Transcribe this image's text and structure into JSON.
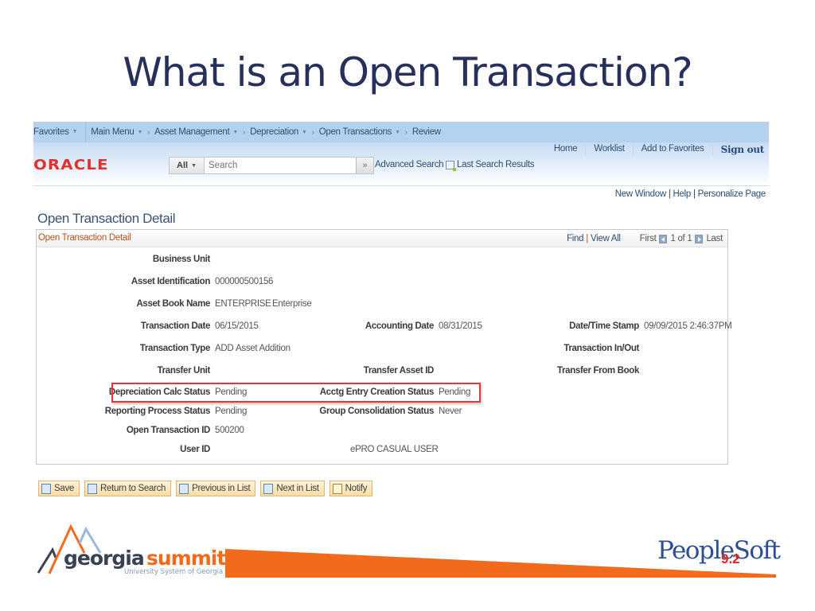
{
  "slide": {
    "title": "What is an Open Transaction?"
  },
  "nav": {
    "favorites": "Favorites",
    "breadcrumb": [
      "Main Menu",
      "Asset Management",
      "Depreciation",
      "Open Transactions",
      "Review"
    ],
    "separator": "›"
  },
  "header": {
    "logo": "ORACLE",
    "search": {
      "scope": "All",
      "placeholder": "Search",
      "go": "»"
    },
    "advanced_search": "Advanced Search",
    "last_search_results": "Last Search Results",
    "top_links": [
      "Home",
      "Worklist",
      "Add to Favorites",
      "Sign out"
    ]
  },
  "utility_links": [
    "New Window",
    "Help",
    "Personalize Page"
  ],
  "page": {
    "title": "Open Transaction Detail",
    "panel_title": "Open Transaction Detail",
    "panel_nav": {
      "find": "Find",
      "view_all": "View All",
      "first": "First",
      "count": "1 of 1",
      "last": "Last"
    }
  },
  "fields": {
    "business_unit": {
      "label": "Business Unit",
      "value": ""
    },
    "asset_identification": {
      "label": "Asset Identification",
      "value": "000000500156"
    },
    "asset_book_name": {
      "label": "Asset Book Name",
      "value": "ENTERPRISE",
      "desc": "Enterprise"
    },
    "transaction_date": {
      "label": "Transaction Date",
      "value": "06/15/2015"
    },
    "accounting_date": {
      "label": "Accounting Date",
      "value": "08/31/2015"
    },
    "datetime_stamp": {
      "label": "Date/Time Stamp",
      "value": "09/09/2015  2:46:37PM"
    },
    "transaction_type": {
      "label": "Transaction Type",
      "value": "ADD",
      "desc": "Asset Addition"
    },
    "transaction_inout": {
      "label": "Transaction In/Out",
      "value": ""
    },
    "transfer_unit": {
      "label": "Transfer Unit",
      "value": ""
    },
    "transfer_asset_id": {
      "label": "Transfer Asset ID",
      "value": ""
    },
    "transfer_from_book": {
      "label": "Transfer From Book",
      "value": ""
    },
    "depreciation_calc_status": {
      "label": "Depreciation Calc Status",
      "value": "Pending"
    },
    "acctg_entry_creation_status": {
      "label": "Acctg Entry Creation Status",
      "value": "Pending"
    },
    "reporting_process_status": {
      "label": "Reporting Process Status",
      "value": "Pending"
    },
    "group_consolidation_status": {
      "label": "Group Consolidation Status",
      "value": "Never"
    },
    "open_transaction_id": {
      "label": "Open Transaction ID",
      "value": "500200"
    },
    "user_id": {
      "label": "User ID",
      "value": "ePRO CASUAL USER"
    }
  },
  "toolbar": {
    "save": "Save",
    "return_to_search": "Return to Search",
    "previous_in_list": "Previous in List",
    "next_in_list": "Next in List",
    "notify": "Notify"
  },
  "footer": {
    "gs_georgia": "georgia",
    "gs_summit": "summit",
    "gs_subtitle": "University System of Georgia",
    "ps_logo": "PeopleSoft",
    "ps_version": "9.2",
    "colors": {
      "orange": "#f26b1d",
      "navy": "#27305a",
      "highlight_red": "#e8343a"
    }
  }
}
